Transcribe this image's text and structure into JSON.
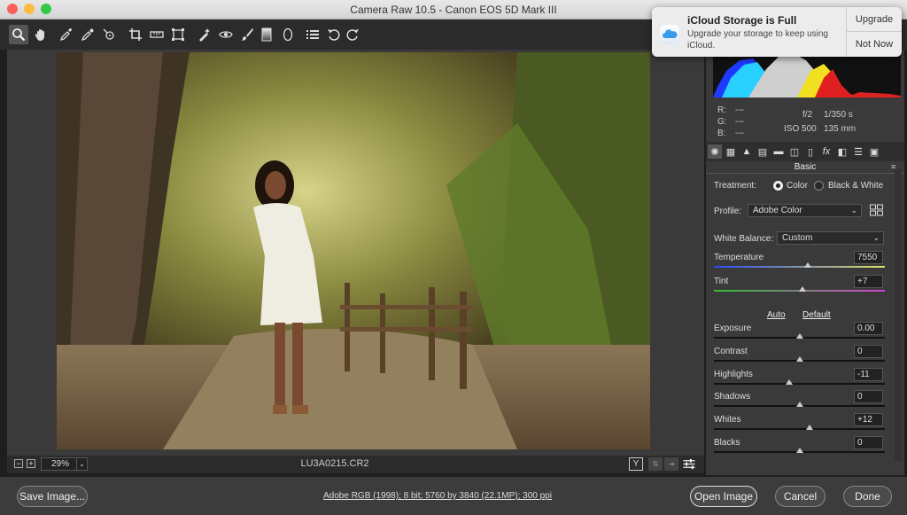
{
  "window": {
    "title": "Camera Raw 10.5  -  Canon EOS 5D Mark III"
  },
  "notification": {
    "title": "iCloud Storage is Full",
    "body": "Upgrade your storage to keep using iCloud.",
    "upgrade_label": "Upgrade",
    "not_now_label": "Not Now"
  },
  "info": {
    "r_label": "R:",
    "r_value": "---",
    "g_label": "G:",
    "g_value": "---",
    "b_label": "B:",
    "b_value": "---",
    "aperture": "f/2",
    "shutter": "1/350 s",
    "iso": "ISO 500",
    "focal": "135 mm"
  },
  "panel": {
    "section_title": "Basic",
    "treatment_label": "Treatment:",
    "color_label": "Color",
    "bw_label": "Black & White",
    "profile_label": "Profile:",
    "profile_value": "Adobe Color",
    "wb_label": "White Balance:",
    "wb_value": "Custom",
    "auto_label": "Auto",
    "default_label": "Default",
    "sliders": [
      {
        "label": "Temperature",
        "value": "7550",
        "position": 0.55
      },
      {
        "label": "Tint",
        "value": "+7",
        "position": 0.52
      },
      {
        "label": "Exposure",
        "value": "0.00",
        "position": 0.5
      },
      {
        "label": "Contrast",
        "value": "0",
        "position": 0.5
      },
      {
        "label": "Highlights",
        "value": "-11",
        "position": 0.44
      },
      {
        "label": "Shadows",
        "value": "0",
        "position": 0.5
      },
      {
        "label": "Whites",
        "value": "+12",
        "position": 0.56
      },
      {
        "label": "Blacks",
        "value": "0",
        "position": 0.5
      }
    ]
  },
  "bottom": {
    "zoom": "29%",
    "filename": "LU3A0215.CR2"
  },
  "footer": {
    "save_label": "Save Image...",
    "workflow": "Adobe RGB (1998); 8 bit; 5760 by 3840 (22.1MP); 300 ppi",
    "open_label": "Open Image",
    "cancel_label": "Cancel",
    "done_label": "Done"
  }
}
